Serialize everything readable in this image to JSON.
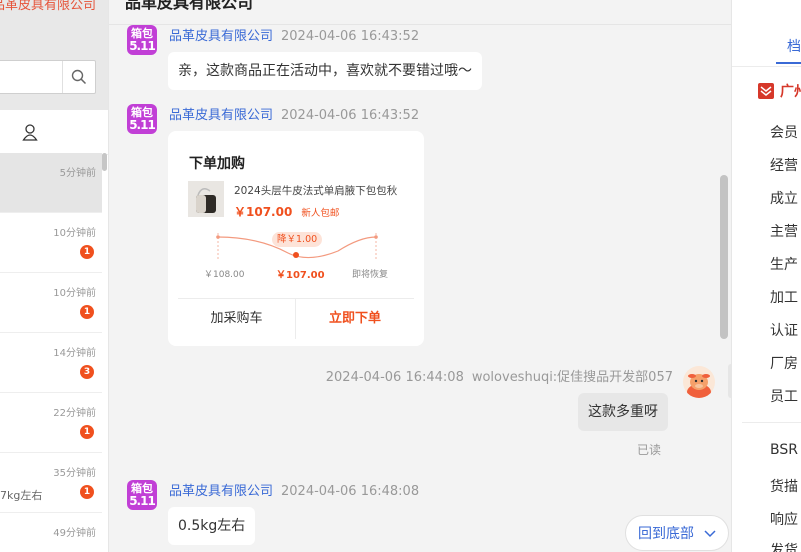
{
  "left": {
    "brand_fragment": "品革皮具有限公司",
    "conversations": [
      {
        "time": "5分钟前",
        "badge": "",
        "preview": ""
      },
      {
        "time": "10分钟前",
        "badge": "1",
        "preview": ""
      },
      {
        "time": "10分钟前",
        "badge": "1",
        "preview": ""
      },
      {
        "time": "14分钟前",
        "badge": "3",
        "preview": ""
      },
      {
        "time": "22分钟前",
        "badge": "1",
        "preview": ""
      },
      {
        "time": "35分钟前",
        "badge": "1",
        "preview": "7kg左右"
      },
      {
        "time": "49分钟前",
        "badge": "",
        "preview": ""
      }
    ]
  },
  "header": {
    "title": "品革皮具有限公司"
  },
  "messages": [
    {
      "sender": "品革皮具有限公司",
      "time": "2024-04-06 16:43:52",
      "text": "亲，这款商品正在活动中，喜欢就不要错过哦～"
    },
    {
      "sender": "品革皮具有限公司",
      "time": "2024-04-06 16:43:52"
    },
    {
      "sender": "woloveshuqi:促佳搜品开发部057",
      "time": "2024-04-06 16:44:08",
      "text": "这款多重呀",
      "status": "已读"
    },
    {
      "sender": "品革皮具有限公司",
      "time": "2024-04-06 16:48:08",
      "text": "0.5kg左右"
    }
  ],
  "avatar_text": {
    "line1": "箱包",
    "line2": "5.11"
  },
  "order_card": {
    "title": "下单加购",
    "product_name": "2024头层牛皮法式单肩腋下包包秋",
    "price": "￥107.00",
    "tag": "新人包邮",
    "discount_label": "降￥1.00",
    "price_before": "￥108.00",
    "price_now": "￥107.00",
    "price_after": "即将恢复",
    "cart_button": "加采购车",
    "buy_button": "立即下单"
  },
  "back_to_bottom": "回到底部",
  "right": {
    "tab": "档",
    "shop_fragment": "广州",
    "rows": [
      "会员",
      "经营",
      "成立",
      "主营",
      "生产",
      "加工",
      "认证",
      "厂房",
      "员工"
    ],
    "rows2": [
      "BSR",
      "货描",
      "响应",
      "发货"
    ]
  },
  "colors": {
    "accent": "#3a6ad6",
    "price": "#f0501e",
    "brand": "#c13fd6",
    "badge": "#f0501e"
  }
}
